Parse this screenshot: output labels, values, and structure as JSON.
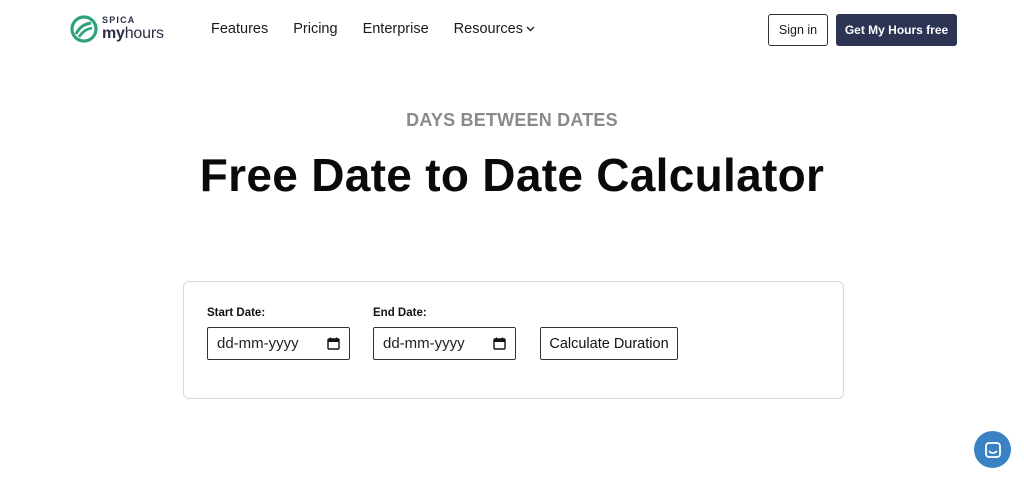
{
  "brand": {
    "top": "SPICA",
    "bottom_bold": "my",
    "bottom_rest": "hours",
    "color": "#2ea37a"
  },
  "nav": {
    "items": [
      "Features",
      "Pricing",
      "Enterprise",
      "Resources"
    ],
    "signin_label": "Sign in",
    "cta_label": "Get My Hours free"
  },
  "hero": {
    "eyebrow": "DAYS BETWEEN DATES",
    "title": "Free Date to Date Calculator"
  },
  "form": {
    "start_label": "Start Date:",
    "start_placeholder": "dd-mm-yyyy",
    "end_label": "End Date:",
    "end_placeholder": "dd-mm-yyyy",
    "button_label": "Calculate Duration"
  },
  "icons": {
    "dropdown": "chevron-down-icon",
    "date": "calendar-icon",
    "chat": "chat-icon"
  },
  "colors": {
    "cta_bg": "#2c3353",
    "chat_bg": "#3b82c4",
    "eyebrow": "#8a8a8a"
  }
}
